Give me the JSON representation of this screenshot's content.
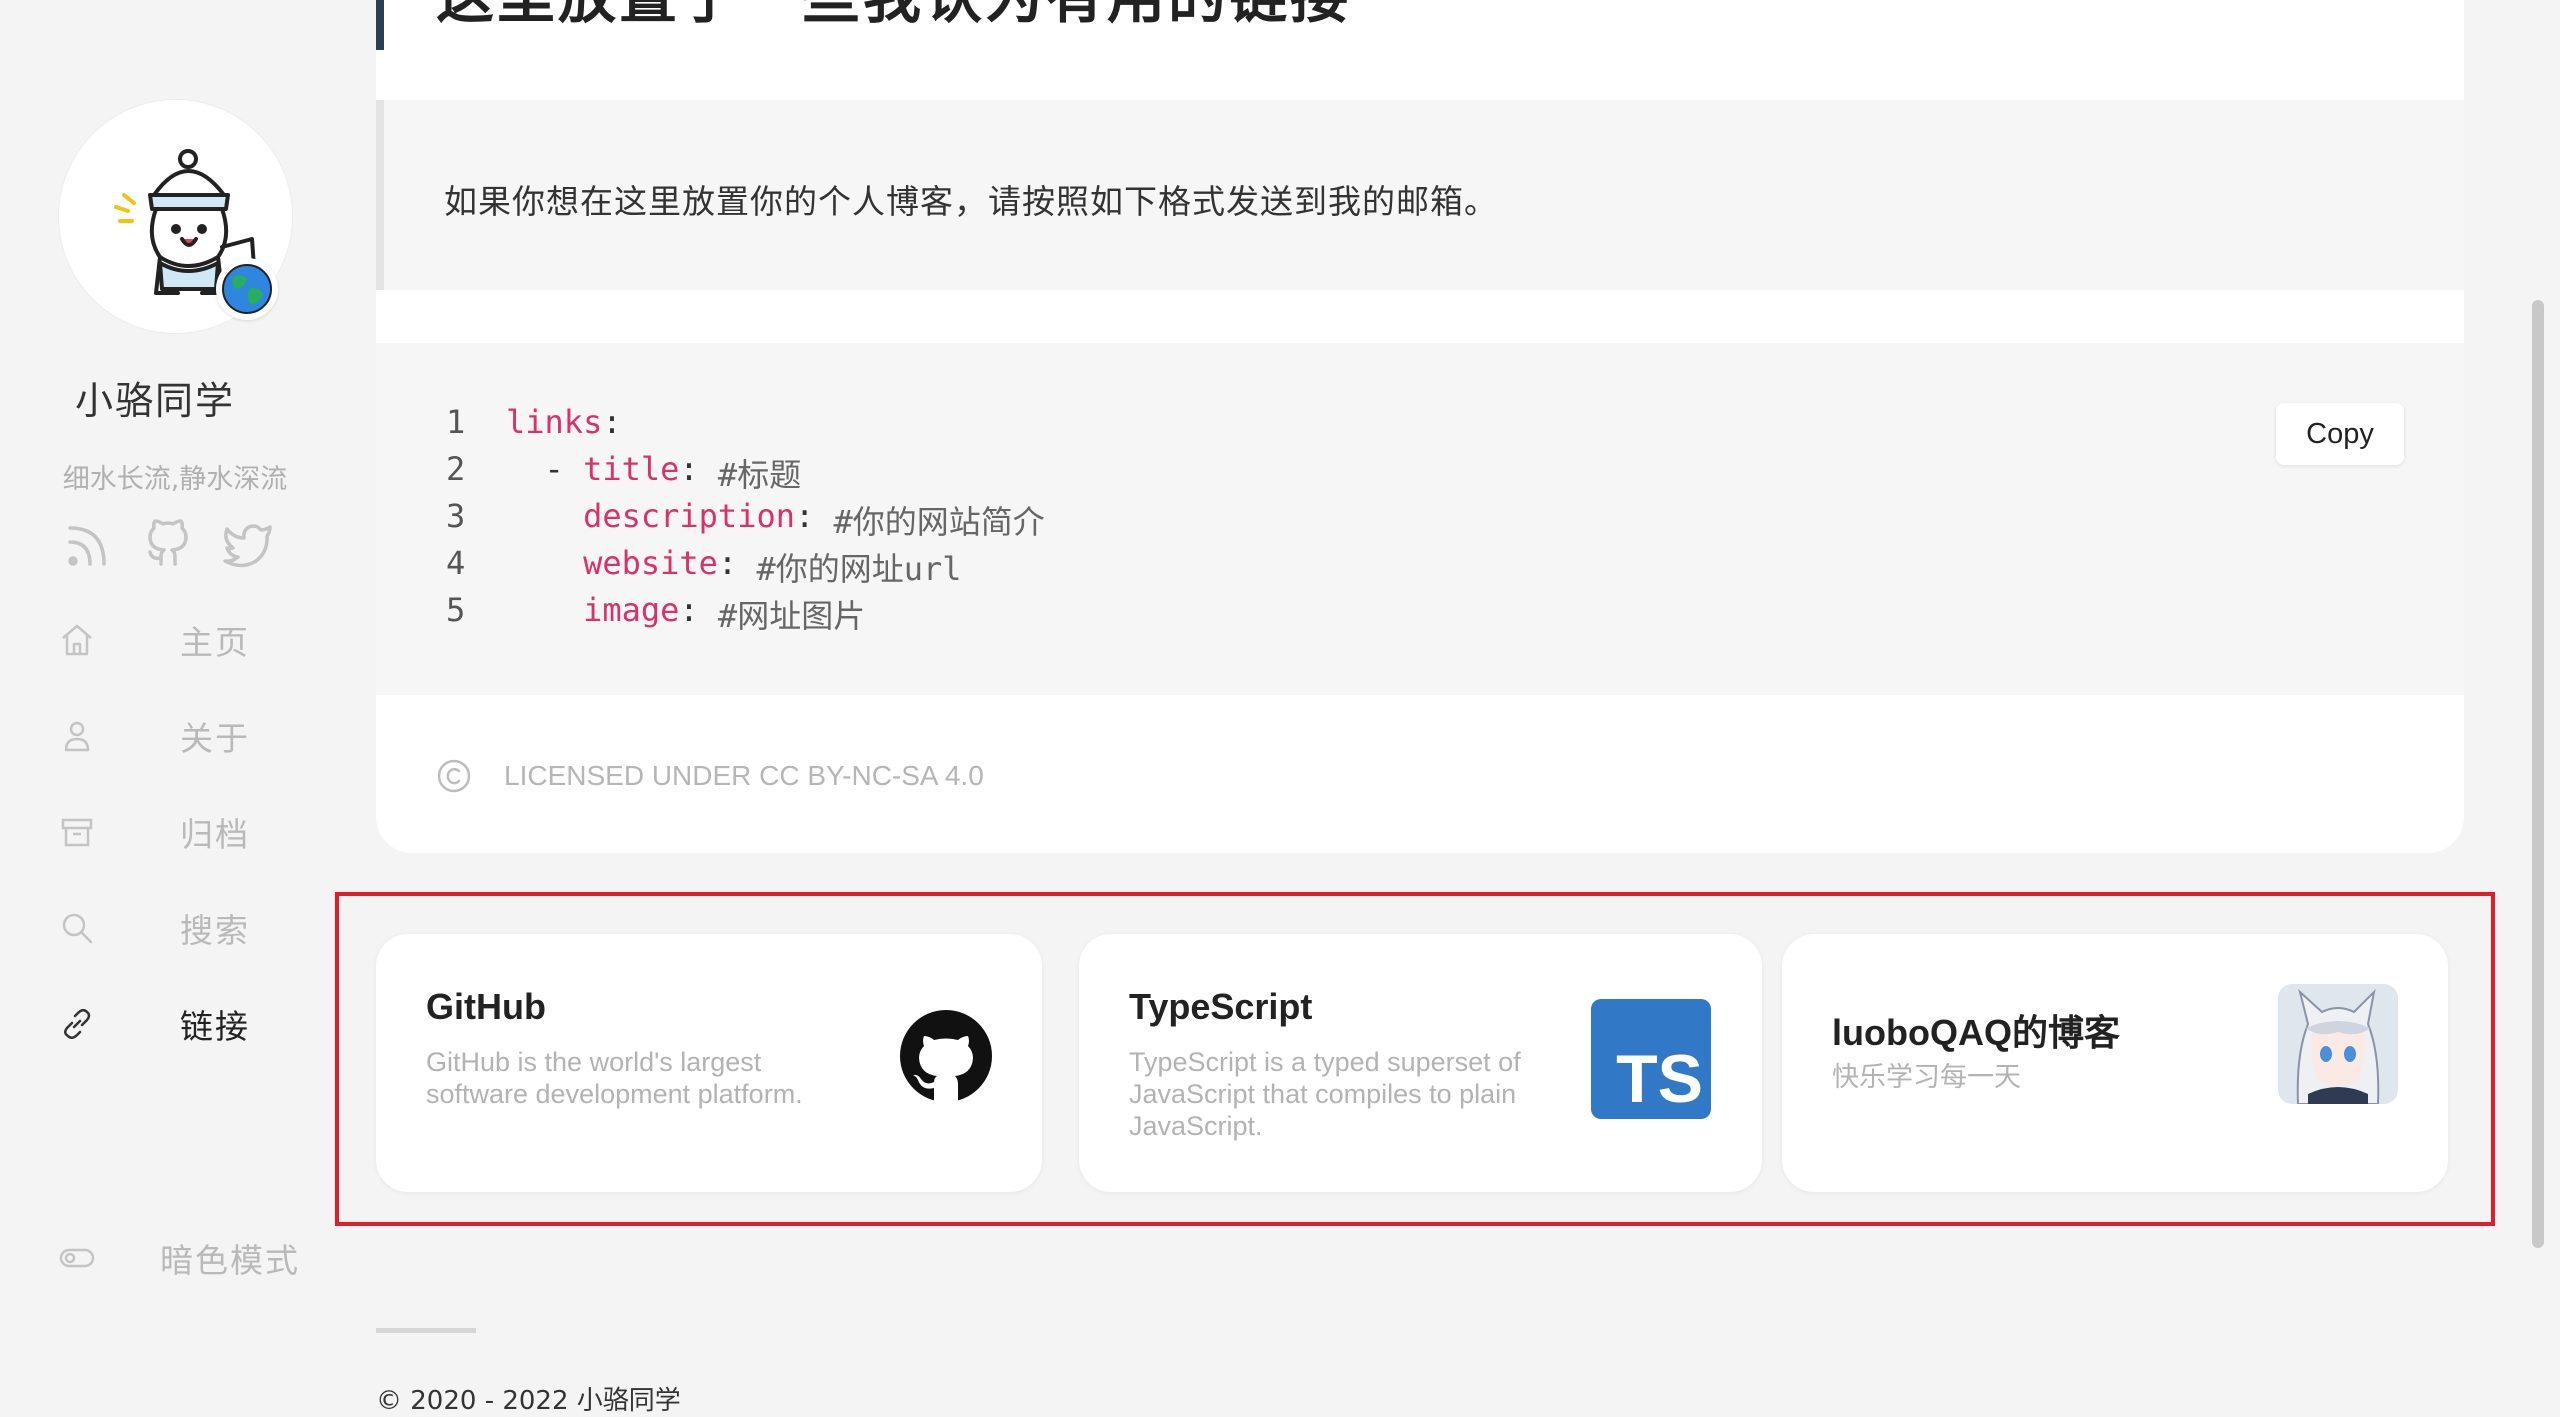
{
  "sidebar": {
    "site_name": "小骆同学",
    "motto": "细水长流,静水深流",
    "social_icons": [
      "rss-icon",
      "github-icon",
      "twitter-icon"
    ],
    "nav": [
      {
        "label": "主页",
        "icon": "home-icon"
      },
      {
        "label": "关于",
        "icon": "user-icon"
      },
      {
        "label": "归档",
        "icon": "archive-icon"
      },
      {
        "label": "搜索",
        "icon": "search-icon"
      },
      {
        "label": "链接",
        "icon": "link-icon",
        "active": true
      }
    ],
    "dark_mode_label": "暗色模式"
  },
  "article": {
    "title": "这里放置了一些我认为有用的链接",
    "quote": "如果你想在这里放置你的个人博客，请按照如下格式发送到我的邮箱。",
    "copy_label": "Copy",
    "code": [
      {
        "n": "1",
        "indent": "",
        "key": "links",
        "sep": ":",
        "comment": ""
      },
      {
        "n": "2",
        "indent": "  - ",
        "key": "title",
        "sep": ": ",
        "comment": "#标题"
      },
      {
        "n": "3",
        "indent": "    ",
        "key": "description",
        "sep": ": ",
        "comment": "#你的网站简介"
      },
      {
        "n": "4",
        "indent": "    ",
        "key": "website",
        "sep": ": ",
        "comment": "#你的网址url"
      },
      {
        "n": "5",
        "indent": "    ",
        "key": "image",
        "sep": ": ",
        "comment": "#网址图片"
      }
    ],
    "license": "LICENSED UNDER CC BY-NC-SA 4.0"
  },
  "links": [
    {
      "title": "GitHub",
      "description": "GitHub is the world's largest software development platform.",
      "image": "github-logo-icon"
    },
    {
      "title": "TypeScript",
      "description": "TypeScript is a typed superset of JavaScript that compiles to plain JavaScript.",
      "image": "typescript-logo-icon",
      "image_text": "TS"
    },
    {
      "title": "luoboQAQ的博客",
      "description": "快乐学习每一天",
      "image": "anime-avatar-image"
    }
  ],
  "footer": {
    "copyright": "© 2020 - 2022 小骆同学"
  },
  "colors": {
    "accent": "#2c3e50",
    "code_key": "#d63369",
    "highlight_border": "#e01e2b",
    "typescript_blue": "#3178c6"
  }
}
